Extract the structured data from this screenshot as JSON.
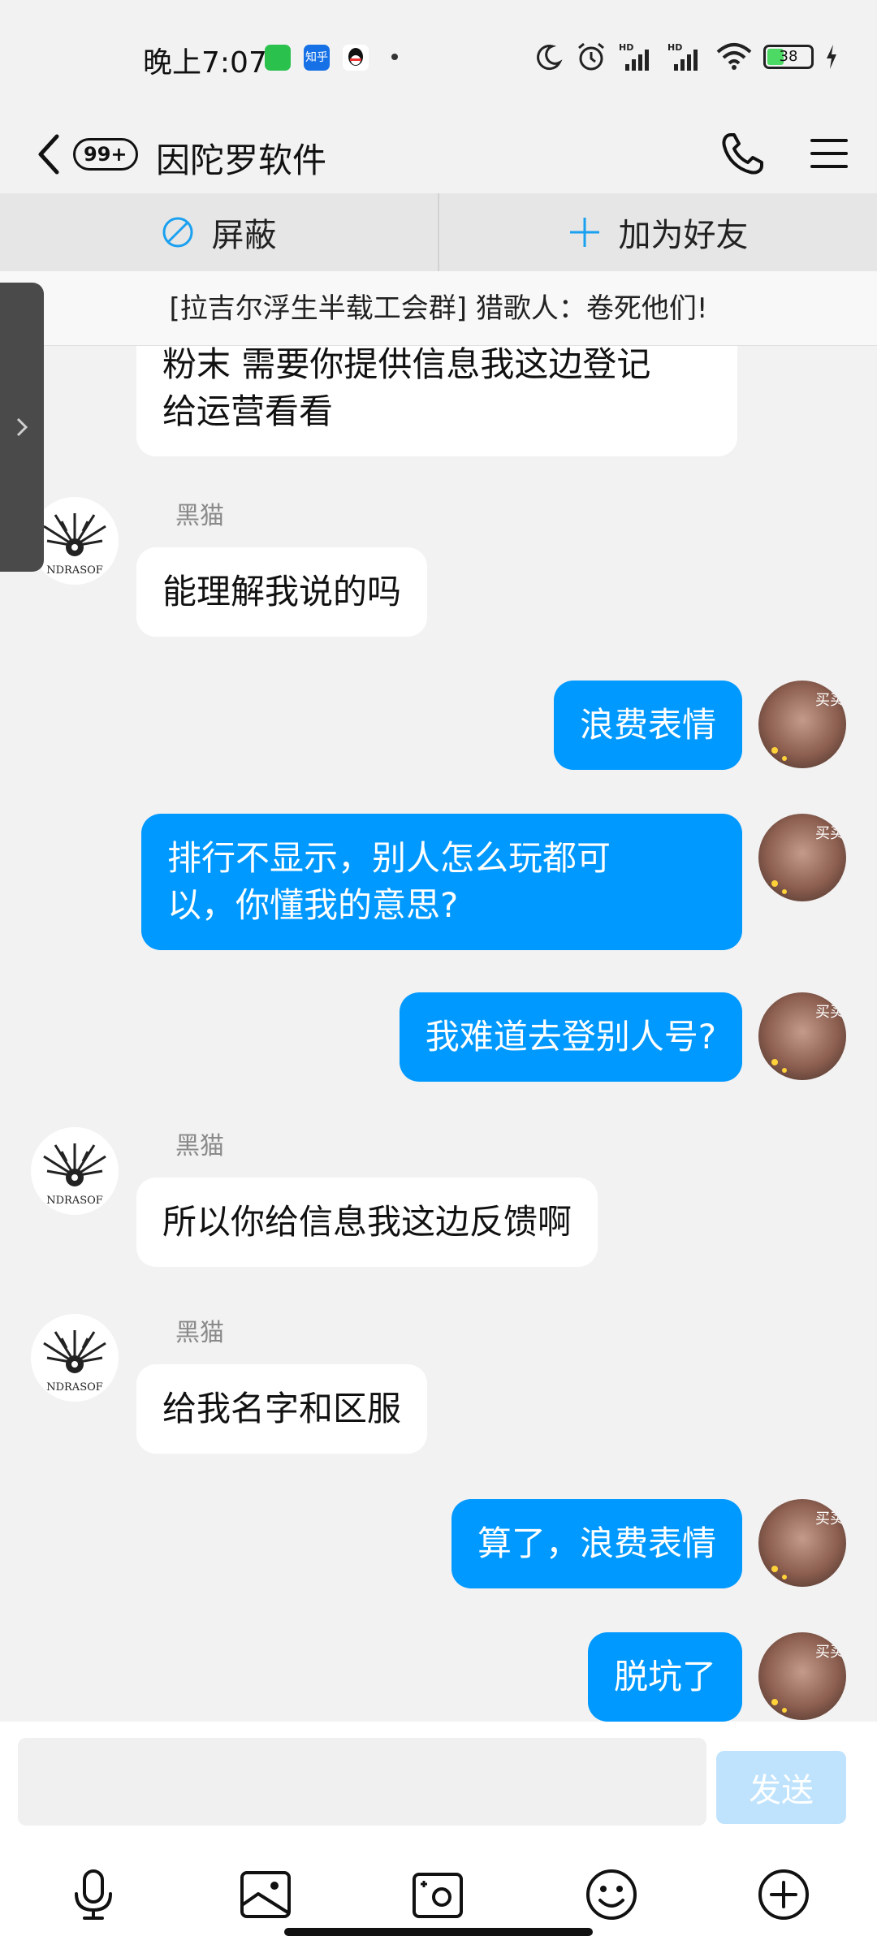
{
  "status_bar": {
    "time": "晚上7:07",
    "zhihu_label": "知乎",
    "battery": "38",
    "network_hd_1": "HD",
    "network_hd_2": "HD"
  },
  "header": {
    "unread_count": "99+",
    "title": "因陀罗软件"
  },
  "actions": {
    "block_label": "屏蔽",
    "add_friend_label": "加为好友"
  },
  "notice": {
    "text": "[拉吉尔浮生半载工会群] 猎歌人：卷死他们!"
  },
  "messages": [
    {
      "side": "in",
      "sender": "",
      "text": "粉末  需要你提供信息我这边登记\n给运营看看"
    },
    {
      "side": "in",
      "sender": "黑猫",
      "text": "能理解我说的吗"
    },
    {
      "side": "out",
      "text": "浪费表情"
    },
    {
      "side": "out",
      "text": "排行不显示，别人怎么玩都可\n以，你懂我的意思?"
    },
    {
      "side": "out",
      "text": "我难道去登别人号?"
    },
    {
      "side": "in",
      "sender": "黑猫",
      "text": "所以你给信息我这边反馈啊"
    },
    {
      "side": "in",
      "sender": "黑猫",
      "text": "给我名字和区服"
    },
    {
      "side": "out",
      "text": "算了，浪费表情"
    },
    {
      "side": "out",
      "text": "脱坑了"
    }
  ],
  "input": {
    "value": "",
    "send_label": "发送"
  },
  "avatar_text": {
    "left_logo": "NDRASOF",
    "right_sticker": "买买"
  },
  "colors": {
    "outgoing_bubble": "#0099ff",
    "incoming_bubble": "#ffffff",
    "background": "#f2f2f2",
    "accent": "#1aa0f0"
  }
}
